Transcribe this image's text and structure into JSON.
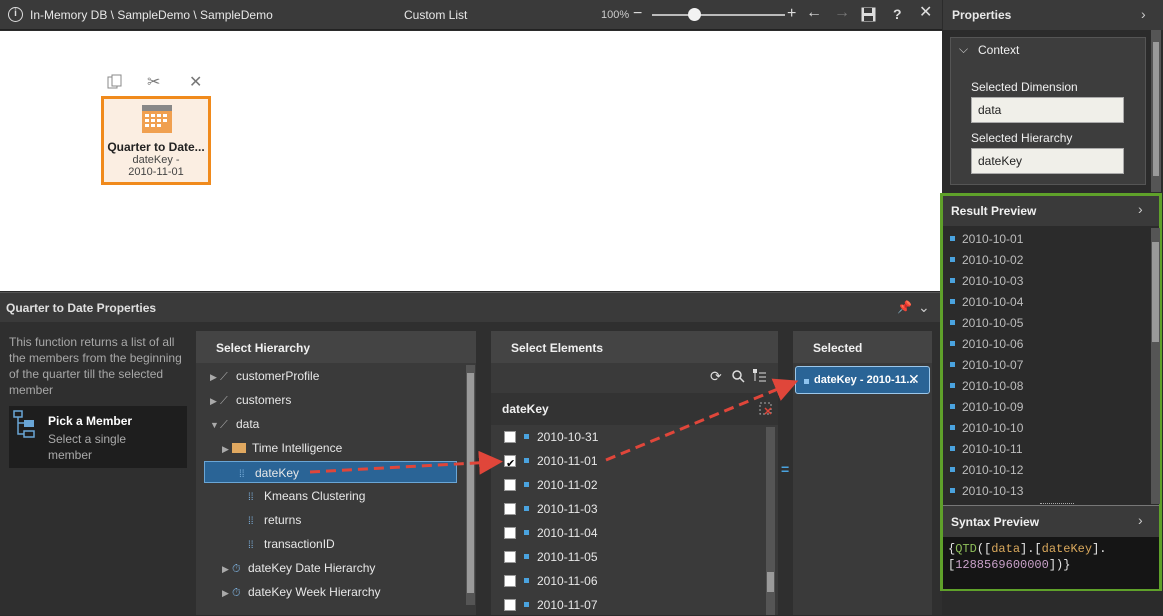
{
  "topbar": {
    "path": "In-Memory DB \\ SampleDemo \\ SampleDemo",
    "title": "Custom List",
    "zoom": "100%"
  },
  "canvas": {
    "card": {
      "title": "Quarter to Date...",
      "line1": "dateKey -",
      "line2": "2010-11-01",
      "accent": "#f08a1c"
    }
  },
  "bottom": {
    "title": "Quarter to Date Properties",
    "description": "This function returns a list of all the members from the beginning of the quarter till the selected member",
    "pick": {
      "title": "Pick a Member",
      "subtitle": "Select a single member"
    },
    "hierarchy": {
      "header": "Select Hierarchy",
      "items": [
        {
          "label": "customerProfile",
          "type": "dimension",
          "expanded": false
        },
        {
          "label": "customers",
          "type": "dimension",
          "expanded": false
        },
        {
          "label": "data",
          "type": "dimension",
          "expanded": true
        },
        {
          "label": "Time Intelligence",
          "type": "folder",
          "expanded": false
        },
        {
          "label": "dateKey",
          "type": "hierarchy",
          "selected": true
        },
        {
          "label": "Kmeans Clustering",
          "type": "hierarchy"
        },
        {
          "label": "returns",
          "type": "hierarchy"
        },
        {
          "label": "transactionID",
          "type": "hierarchy"
        },
        {
          "label": "dateKey Date Hierarchy",
          "type": "date-hierarchy",
          "expanded": false
        },
        {
          "label": "dateKey Week Hierarchy",
          "type": "date-hierarchy",
          "expanded": false
        }
      ]
    },
    "elements": {
      "header": "Select Elements",
      "subheader": "dateKey",
      "items": [
        {
          "label": "2010-10-31",
          "checked": false
        },
        {
          "label": "2010-11-01",
          "checked": true
        },
        {
          "label": "2010-11-02",
          "checked": false
        },
        {
          "label": "2010-11-03",
          "checked": false
        },
        {
          "label": "2010-11-04",
          "checked": false
        },
        {
          "label": "2010-11-05",
          "checked": false
        },
        {
          "label": "2010-11-06",
          "checked": false
        },
        {
          "label": "2010-11-07",
          "checked": false
        }
      ]
    },
    "selected": {
      "header": "Selected",
      "chip": "dateKey - 2010-11..."
    },
    "equals": "="
  },
  "properties": {
    "header": "Properties",
    "context": {
      "header": "Context",
      "dimension_label": "Selected Dimension",
      "dimension_value": "data",
      "hierarchy_label": "Selected Hierarchy",
      "hierarchy_value": "dateKey"
    }
  },
  "result_preview": {
    "header": "Result Preview",
    "items": [
      "2010-10-01",
      "2010-10-02",
      "2010-10-03",
      "2010-10-04",
      "2010-10-05",
      "2010-10-06",
      "2010-10-07",
      "2010-10-08",
      "2010-10-09",
      "2010-10-10",
      "2010-10-11",
      "2010-10-12",
      "2010-10-13"
    ]
  },
  "syntax_preview": {
    "header": "Syntax Preview",
    "p1": "{",
    "fn": "QTD",
    "p2": "([",
    "dim": "data",
    "p3": "].[",
    "hier": "dateKey",
    "p4": "].",
    "p5": "[",
    "key": "1288569600000",
    "p6": "])}"
  },
  "colors": {
    "highlight": "#5fa12a",
    "accent": "#f08a1c",
    "selection": "#2a6496",
    "arrow": "#e0463a"
  }
}
